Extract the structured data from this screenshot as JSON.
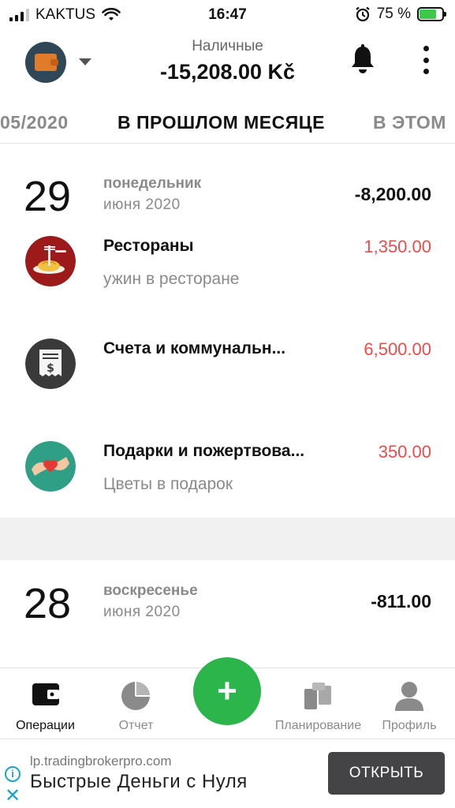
{
  "status_bar": {
    "carrier": "KAKTUS",
    "time": "16:47",
    "battery_percent": "75 %",
    "battery_level": 0.75
  },
  "header": {
    "account_name": "Наличные",
    "account_balance": "-15,208.00 Kč",
    "account_icon": "wallet-icon"
  },
  "period_tabs": {
    "prev": "05/2020",
    "active": "В ПРОШЛОМ МЕСЯЦЕ",
    "next": "В ЭТОМ"
  },
  "days": [
    {
      "day": "29",
      "weekday": "понедельник",
      "month": "июня 2020",
      "total": "-8,200.00",
      "transactions": [
        {
          "category": "Рестораны",
          "note": "ужин в ресторане",
          "amount": "1,350.00",
          "icon": "restaurant-icon"
        },
        {
          "category": "Счета и коммунальн...",
          "note": "",
          "amount": "6,500.00",
          "icon": "bill-icon"
        },
        {
          "category": "Подарки и пожертвова...",
          "note": "Цветы в подарок",
          "amount": "350.00",
          "icon": "gift-donation-icon"
        }
      ]
    },
    {
      "day": "28",
      "weekday": "воскресенье",
      "month": "июня 2020",
      "total": "-811.00"
    }
  ],
  "colors": {
    "expense": "#ef4b4b",
    "accent": "#2bb54a",
    "active_nav": "#111111",
    "inactive_nav": "#8a8a8a"
  },
  "bottom_nav": {
    "items": [
      {
        "label": "Операции",
        "icon": "wallet-icon",
        "active": true
      },
      {
        "label": "Отчет",
        "icon": "pie-chart-icon",
        "active": false
      },
      {
        "label": "",
        "icon": "plus-icon",
        "active": false
      },
      {
        "label": "Планирование",
        "icon": "planning-icon",
        "active": false
      },
      {
        "label": "Профиль",
        "icon": "profile-icon",
        "active": false
      }
    ]
  },
  "ad": {
    "url": "lp.tradingbrokerpro.com",
    "title": "Быстрые Деньги с Нуля",
    "button": "ОТКРЫТЬ"
  }
}
